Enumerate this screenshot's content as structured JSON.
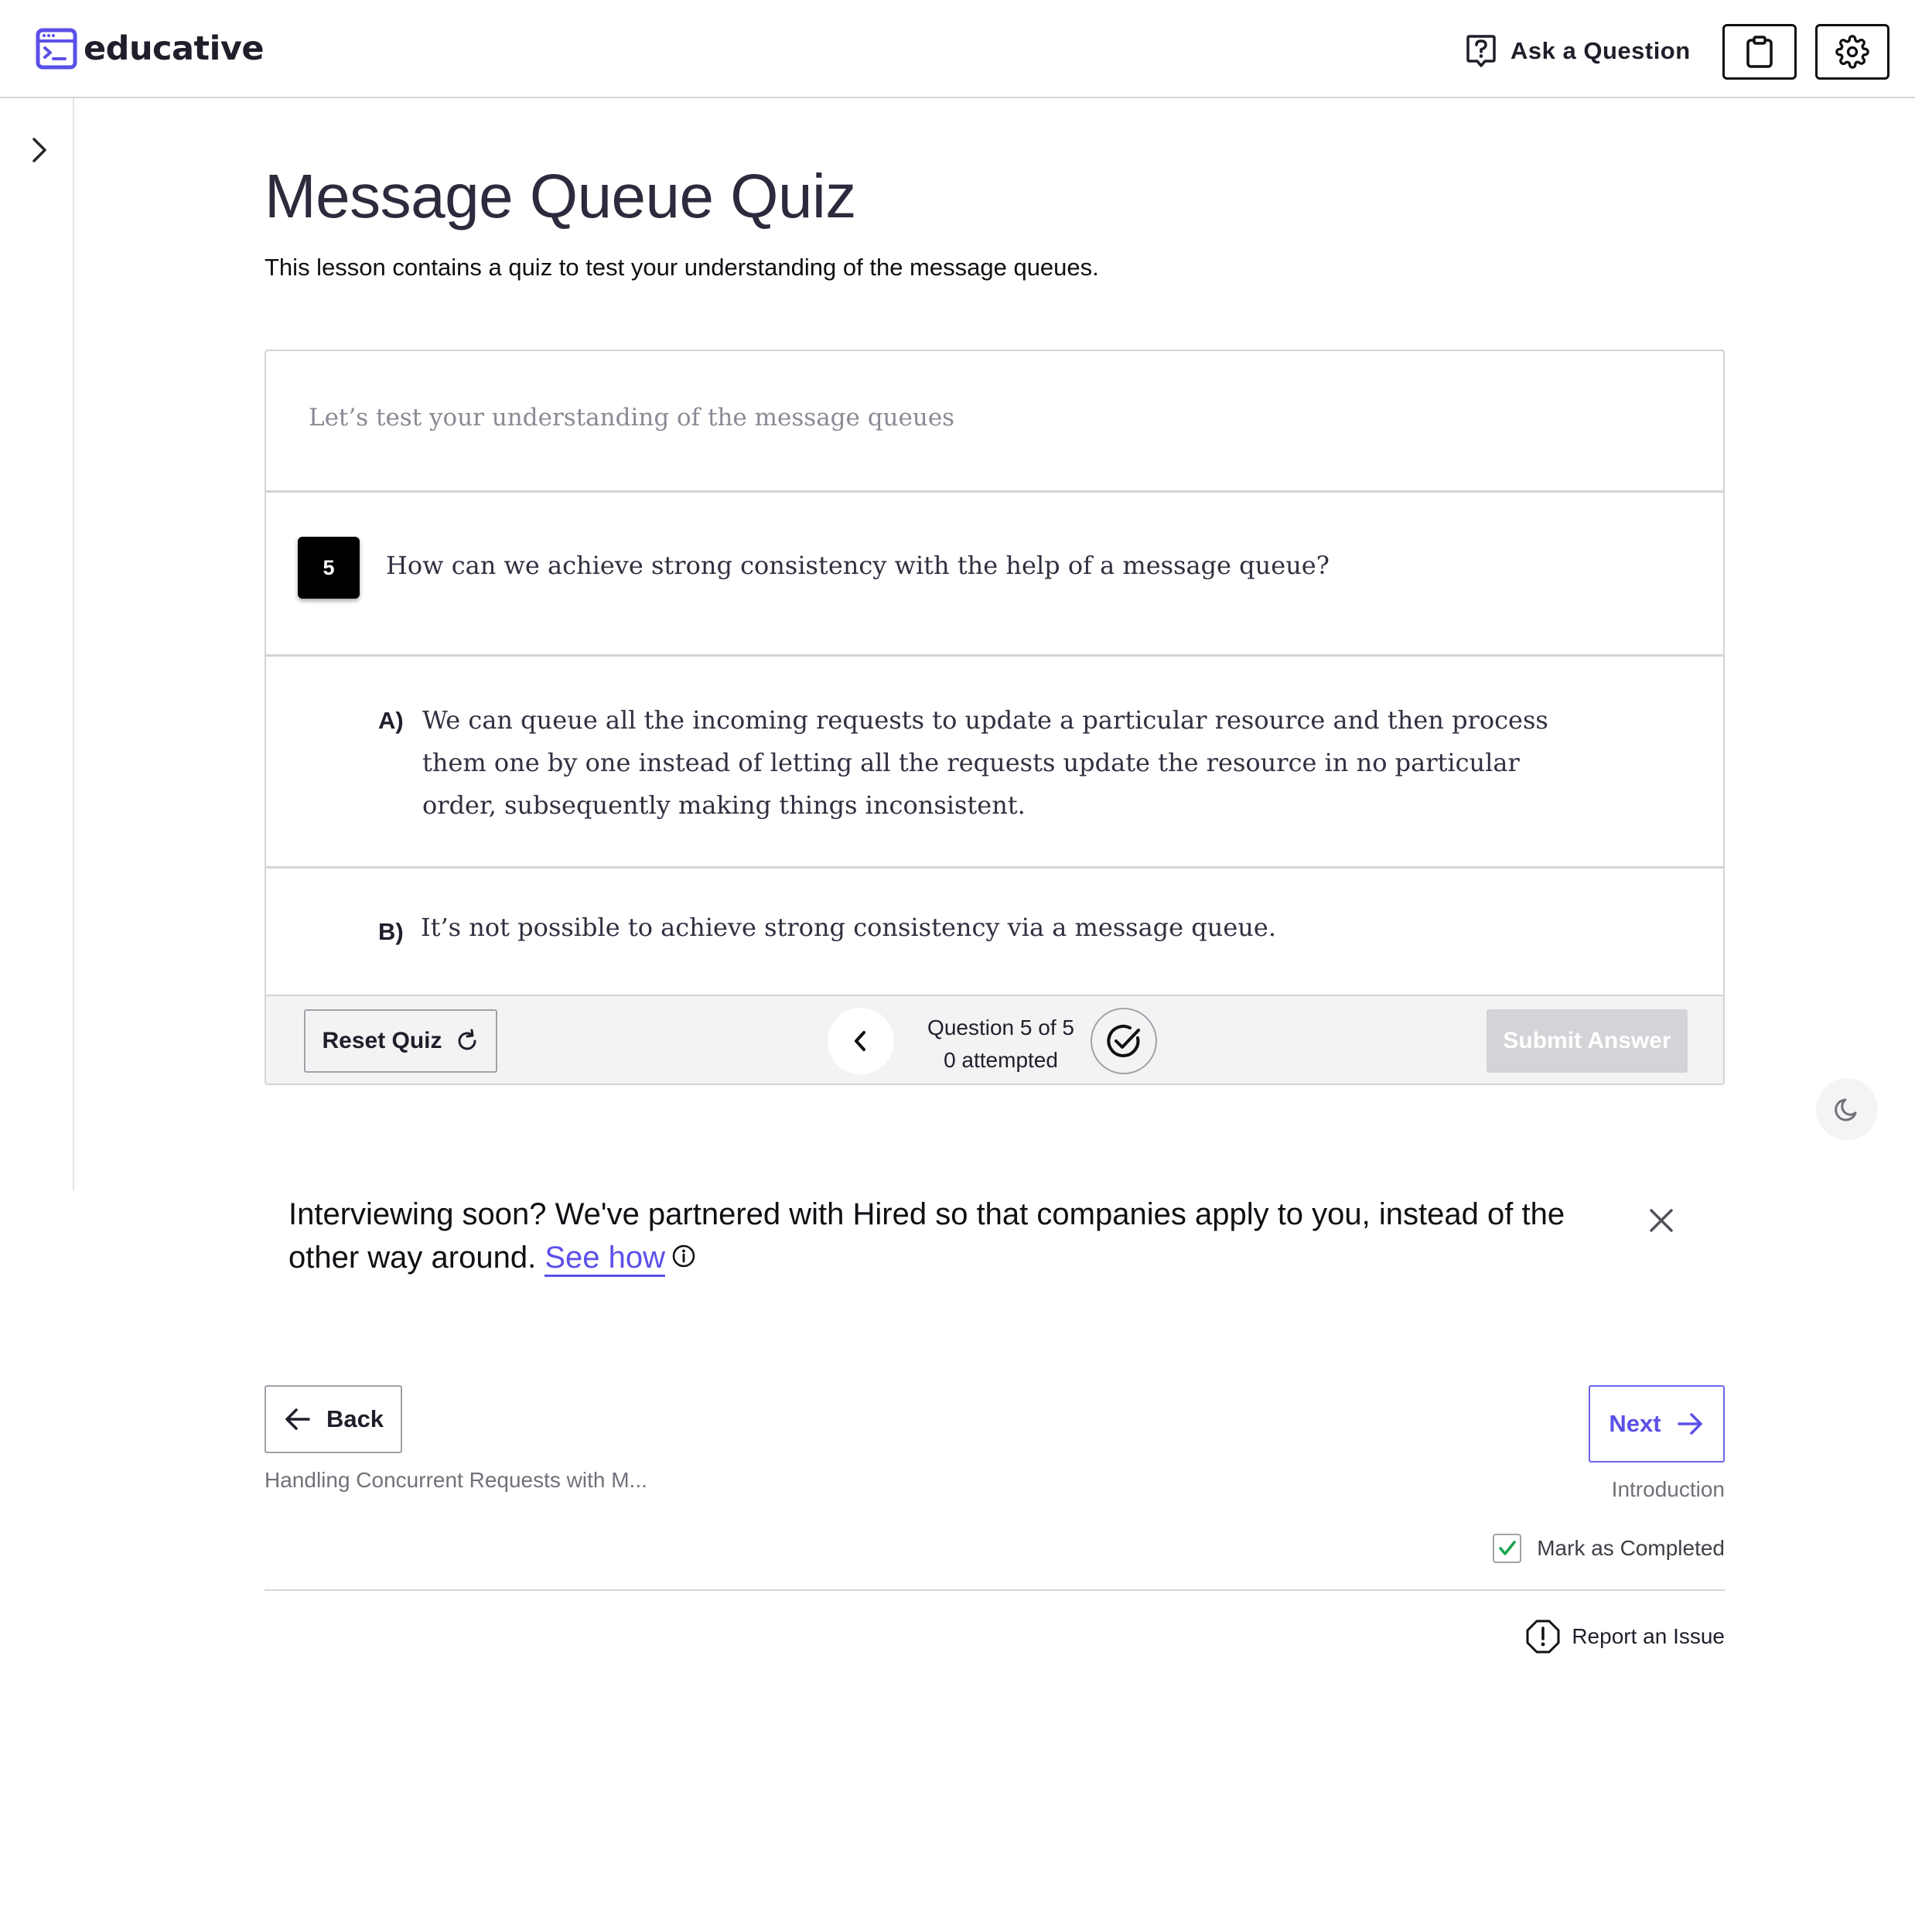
{
  "header": {
    "logo_text": "educative",
    "ask_label": "Ask a Question",
    "icons": [
      "terminal-logo-icon",
      "question-bubble-icon",
      "clipboard-icon",
      "gear-icon"
    ]
  },
  "sidebar": {
    "toggle_icon": "chevron-right-icon"
  },
  "lesson": {
    "title": "Message Queue Quiz",
    "subtitle": "This lesson contains a quiz to test your understanding of the message queues."
  },
  "quiz": {
    "intro": "Let’s test your understanding of the message queues",
    "question_number": "5",
    "question": "How can we achieve strong consistency with the help of a message queue?",
    "options": [
      {
        "letter": "A)",
        "text": "We can queue all the incoming requests to update a particular resource and then process them one by one instead of letting all the requests update the resource in no particular order, subsequently making things inconsistent."
      },
      {
        "letter": "B)",
        "text": "It’s not possible to achieve strong consistency via a message queue."
      }
    ],
    "footer": {
      "reset_label": "Reset Quiz",
      "progress_line1": "Question 5 of 5",
      "progress_line2": "0 attempted",
      "submit_label": "Submit Answer"
    }
  },
  "promo": {
    "text": "Interviewing soon? We've partnered with Hired so that companies apply to you, instead of the other way around.",
    "link": "See how"
  },
  "nav": {
    "back_label": "Back",
    "back_lesson": "Handling Concurrent Requests with M...",
    "next_label": "Next",
    "next_lesson": "Introduction",
    "mark_completed": "Mark as Completed",
    "mark_completed_checked": true,
    "report_label": "Report an Issue"
  },
  "colors": {
    "accent": "#5b50e8",
    "text": "#2b2b3d",
    "check": "#16a34a"
  }
}
